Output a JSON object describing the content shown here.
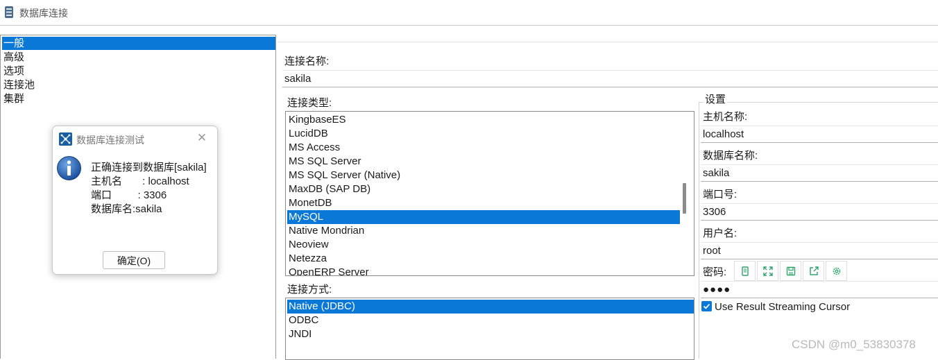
{
  "window": {
    "title": "数据库连接",
    "icon": "database-icon"
  },
  "nav": {
    "items": [
      {
        "label": "一般",
        "selected": true
      },
      {
        "label": "高级",
        "selected": false
      },
      {
        "label": "选项",
        "selected": false
      },
      {
        "label": "连接池",
        "selected": false
      },
      {
        "label": "集群",
        "selected": false
      }
    ]
  },
  "dialog": {
    "title": "数据库连接测试",
    "close_glyph": "✕",
    "icon": "info-icon",
    "lines": [
      "正确连接到数据库[sakila]",
      "主机名       : localhost",
      "端口         : 3306",
      "数据库名:sakila"
    ],
    "ok_label": "确定(O)"
  },
  "connection": {
    "name_label": "连接名称:",
    "name_value": "sakila",
    "type_label": "连接类型:",
    "types": [
      {
        "label": "KingbaseES",
        "selected": false
      },
      {
        "label": "LucidDB",
        "selected": false
      },
      {
        "label": "MS Access",
        "selected": false
      },
      {
        "label": "MS SQL Server",
        "selected": false
      },
      {
        "label": "MS SQL Server (Native)",
        "selected": false
      },
      {
        "label": "MaxDB (SAP DB)",
        "selected": false
      },
      {
        "label": "MonetDB",
        "selected": false
      },
      {
        "label": "MySQL",
        "selected": true
      },
      {
        "label": "Native Mondrian",
        "selected": false
      },
      {
        "label": "Neoview",
        "selected": false
      },
      {
        "label": "Netezza",
        "selected": false
      },
      {
        "label": "OpenERP Server",
        "selected": false
      }
    ],
    "method_label": "连接方式:",
    "methods": [
      {
        "label": "Native (JDBC)",
        "selected": true
      },
      {
        "label": "ODBC",
        "selected": false
      },
      {
        "label": "JNDI",
        "selected": false
      }
    ]
  },
  "settings": {
    "legend": "设置",
    "host_label": "主机名称:",
    "host_value": "localhost",
    "db_label": "数据库名称:",
    "db_value": "sakila",
    "port_label": "端口号:",
    "port_value": "3306",
    "user_label": "用户名:",
    "user_value": "root",
    "password_label": "密码:",
    "password_value": "●●●●",
    "password_toolbar_icons": [
      "mobile-icon",
      "expand-icon",
      "save-icon",
      "share-icon",
      "gear-icon"
    ],
    "streaming_label": "Use Result Streaming Cursor",
    "streaming_checked": true
  },
  "watermark": "CSDN @m0_53830378",
  "colors": {
    "selection": "#0a78d7",
    "toolbar_icon": "#2fa36b"
  }
}
